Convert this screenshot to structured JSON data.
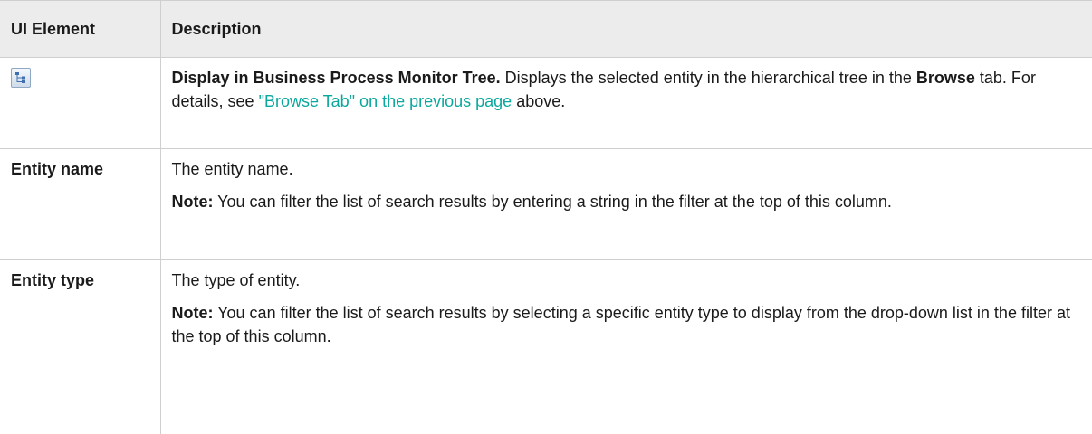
{
  "table": {
    "headers": [
      "UI Element",
      "Description"
    ],
    "rows": [
      {
        "element_icon": "tree-hierarchy-icon",
        "title": "Display in Business Process Monitor Tree.",
        "text_1": " Displays the selected entity in the hierarchical tree in the ",
        "bold_1": "Browse",
        "text_2": " tab. For details, see ",
        "link": "\"Browse Tab\" on the previous page",
        "text_3": " above."
      },
      {
        "element": "Entity name",
        "description": "The entity name.",
        "note_label": "Note:",
        "note_text": " You can filter the list of search results by entering a string in the filter at the top of this column."
      },
      {
        "element": "Entity type",
        "description": "The type of entity.",
        "note_label": "Note:",
        "note_text": " You can filter the list of search results by selecting a specific entity type to display from the drop-down list in the filter at the top of this column."
      }
    ]
  },
  "colors": {
    "header_bg": "#ececec",
    "link": "#0aa89d",
    "border": "#cfcfcf"
  }
}
